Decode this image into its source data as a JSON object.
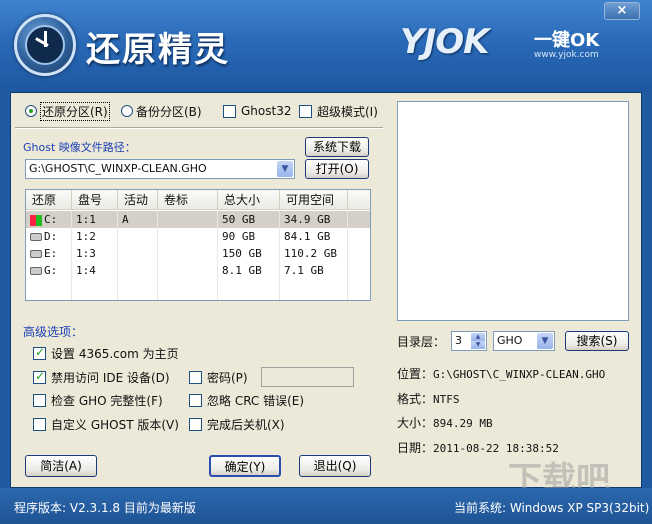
{
  "app": {
    "title": "还原精灵",
    "brand": "YJOK",
    "brand_tag": "一键OK",
    "brand_url": "www.yjok.com",
    "close": "×"
  },
  "mode": {
    "restore": "还原分区(R)",
    "backup": "备份分区(B)",
    "ghost32": "Ghost32",
    "super": "超级模式(I)"
  },
  "ghost": {
    "path_label": "Ghost 映像文件路径：",
    "download_btn": "系统下载",
    "path_value": "G:\\GHOST\\C_WINXP-CLEAN.GHO",
    "open_btn": "打开(O)"
  },
  "table": {
    "headers": [
      "还原",
      "盘号",
      "活动",
      "卷标",
      "总大小",
      "可用空间"
    ],
    "rows": [
      {
        "drive": "C:",
        "disk": "1:1",
        "active": "A",
        "label": "",
        "total": "50 GB",
        "free": "34.9 GB"
      },
      {
        "drive": "D:",
        "disk": "1:2",
        "active": "",
        "label": "",
        "total": "90 GB",
        "free": "84.1 GB"
      },
      {
        "drive": "E:",
        "disk": "1:3",
        "active": "",
        "label": "",
        "total": "150 GB",
        "free": "110.2 GB"
      },
      {
        "drive": "G:",
        "disk": "1:4",
        "active": "",
        "label": "",
        "total": "8.1 GB",
        "free": "7.1 GB"
      }
    ]
  },
  "advanced": {
    "title": "高级选项：",
    "homepage": "设置 4365.com 为主页",
    "disable_ide": "禁用访问 IDE 设备(D)",
    "password": "密码(P)",
    "check_gho": "检查 GHO 完整性(F)",
    "ignore_crc": "忽略 CRC 错误(E)",
    "custom_ghost": "自定义 GHOST 版本(V)",
    "shutdown": "完成后关机(X)"
  },
  "buttons": {
    "simple": "简洁(A)",
    "ok": "确定(Y)",
    "exit": "退出(Q)"
  },
  "right": {
    "dir_label": "目录层：",
    "dir_value": "3",
    "ext_value": "GHO",
    "search_btn": "搜索(S)",
    "location_label": "位置：",
    "location_value": "G:\\GHOST\\C_WINXP-CLEAN.GHO",
    "format_label": "格式：",
    "format_value": "NTFS",
    "size_label": "大小：",
    "size_value": "894.29 MB",
    "date_label": "日期：",
    "date_value": "2011-08-22   18:38:52"
  },
  "status": {
    "version": "程序版本: V2.3.1.8  目前为最新版",
    "system": "当前系统: Windows XP SP3(32bit)"
  },
  "watermark": "下载吧",
  "colors": {
    "header": "#2a6ab8",
    "body": "#ece9d8",
    "status": "#1e5494",
    "accent_text": "#1b3fb5"
  }
}
